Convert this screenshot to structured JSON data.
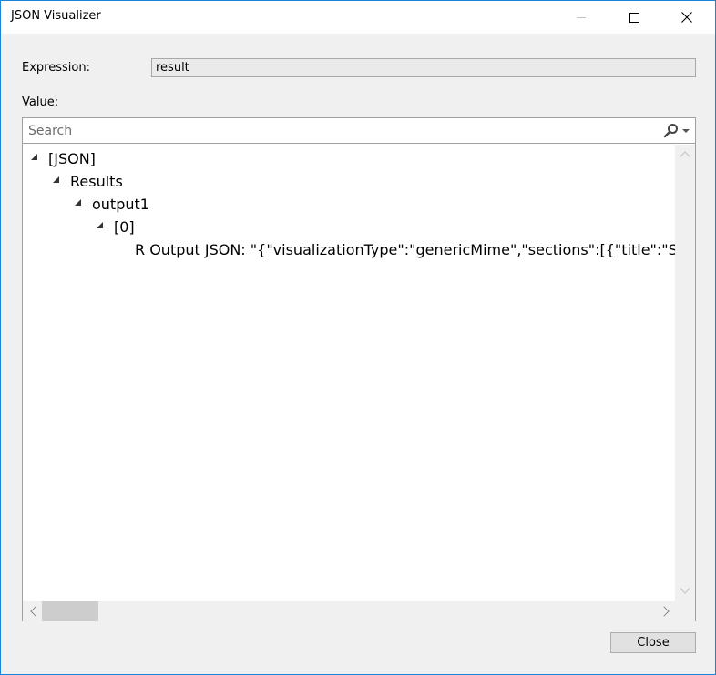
{
  "window": {
    "title": "JSON Visualizer",
    "controls": [
      "minimize-icon",
      "maximize-icon",
      "close-icon"
    ]
  },
  "expression": {
    "label": "Expression:",
    "value": "result"
  },
  "value_section": {
    "label": "Value:"
  },
  "search": {
    "placeholder": "Search",
    "icon": "search-icon"
  },
  "tree": {
    "root": "[JSON]",
    "results": "Results",
    "output": "output1",
    "index": "[0]",
    "leaf": "R Output JSON: \"{\"visualizationType\":\"genericMime\",\"sections\":[{\"title\":\"Stan"
  },
  "buttons": {
    "close": "Close"
  },
  "colors": {
    "window_border": "#1883d7",
    "background": "#f0f0f0",
    "panel": "#ffffff"
  }
}
